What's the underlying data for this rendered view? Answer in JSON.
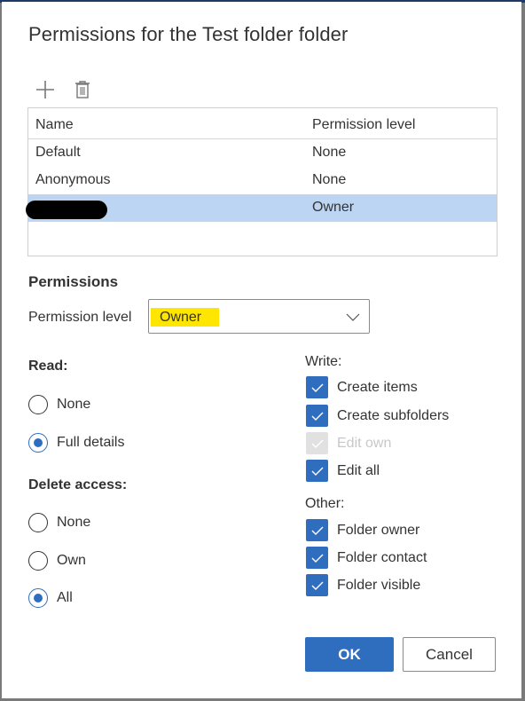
{
  "dialog": {
    "title": "Permissions for the Test folder folder"
  },
  "toolbar": {
    "add_icon": "plus-icon",
    "delete_icon": "trash-icon"
  },
  "table": {
    "columns": [
      "Name",
      "Permission level"
    ],
    "rows": [
      {
        "name": "Default",
        "level": "None",
        "selected": false
      },
      {
        "name": "Anonymous",
        "level": "None",
        "selected": false
      },
      {
        "name": "[redacted]",
        "level": "Owner",
        "selected": true
      }
    ]
  },
  "permissions": {
    "title": "Permissions",
    "level_label": "Permission level",
    "level_value": "Owner",
    "highlight_color": "#ffe600"
  },
  "read": {
    "label": "Read:",
    "options": [
      {
        "label": "None",
        "checked": false
      },
      {
        "label": "Full details",
        "checked": true
      }
    ]
  },
  "delete_access": {
    "label": "Delete access:",
    "options": [
      {
        "label": "None",
        "checked": false
      },
      {
        "label": "Own",
        "checked": false
      },
      {
        "label": "All",
        "checked": true
      }
    ]
  },
  "write": {
    "label": "Write:",
    "options": [
      {
        "label": "Create items",
        "checked": true,
        "disabled": false
      },
      {
        "label": "Create subfolders",
        "checked": true,
        "disabled": false
      },
      {
        "label": "Edit own",
        "checked": true,
        "disabled": true
      },
      {
        "label": "Edit all",
        "checked": true,
        "disabled": false
      }
    ]
  },
  "other": {
    "label": "Other:",
    "options": [
      {
        "label": "Folder owner",
        "checked": true
      },
      {
        "label": "Folder contact",
        "checked": true
      },
      {
        "label": "Folder visible",
        "checked": true
      }
    ]
  },
  "buttons": {
    "ok": "OK",
    "cancel": "Cancel"
  },
  "colors": {
    "accent": "#2f6ebf",
    "selected_row": "#bcd5f2"
  }
}
